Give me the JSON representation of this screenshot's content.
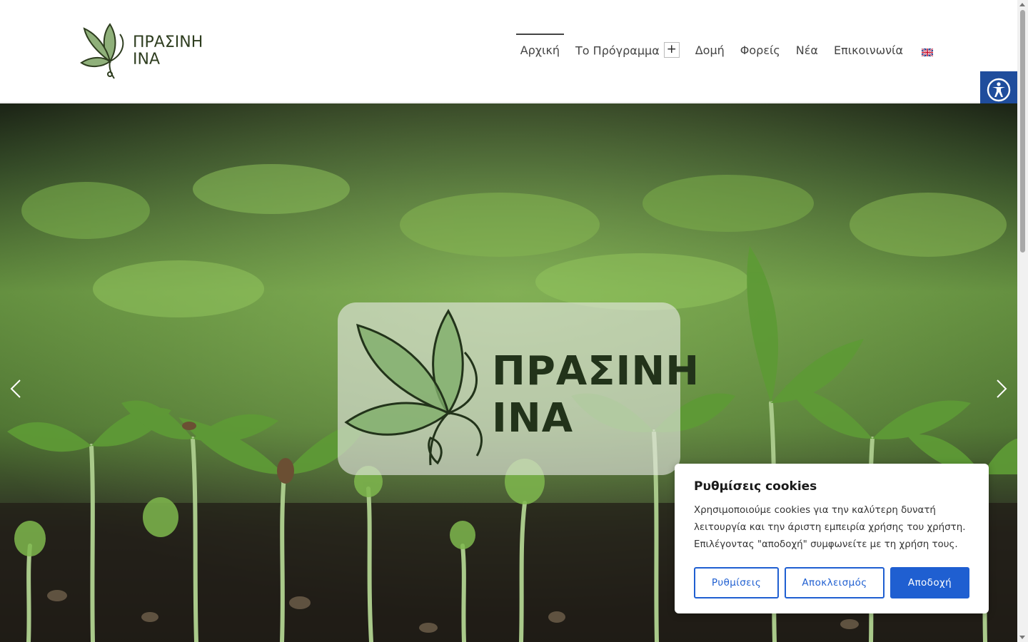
{
  "logo": {
    "line1": "ΠΡΑΣΙΝΗ",
    "line2": "ΙΝΑ"
  },
  "nav": {
    "items": [
      {
        "label": "Αρχική"
      },
      {
        "label": "Το Πρόγραμμα"
      },
      {
        "label": "Δομή"
      },
      {
        "label": "Φορείς"
      },
      {
        "label": "Νέα"
      },
      {
        "label": "Επικοινωνία"
      }
    ],
    "submenu_toggle": "+",
    "active": "Αρχική",
    "language_flag": "uk-flag-icon"
  },
  "hero": {
    "card_line1": "ΠΡΑΣΙΝΗ",
    "card_line2": "ΙΝΑ",
    "prev_icon": "chevron-left-icon",
    "next_icon": "chevron-right-icon"
  },
  "accessibility": {
    "icon": "accessibility-icon"
  },
  "cookie": {
    "title": "Ρυθμίσεις cookies",
    "text": "Χρησιμοποιούμε cookies για την καλύτερη δυνατή λειτουργία και την άριστη εμπειρία χρήσης του χρήστη. Επιλέγοντας \"αποδοχή\" συμφωνείτε με τη χρήση τους.",
    "settings_label": "Ρυθμίσεις",
    "reject_label": "Αποκλεισμός",
    "accept_label": "Αποδοχή"
  },
  "colors": {
    "brand_green": "#2e3d1f",
    "leaf_green": "#8fb07a",
    "accent_blue": "#1f5fd1",
    "a11y_blue": "#1f4d9c"
  }
}
